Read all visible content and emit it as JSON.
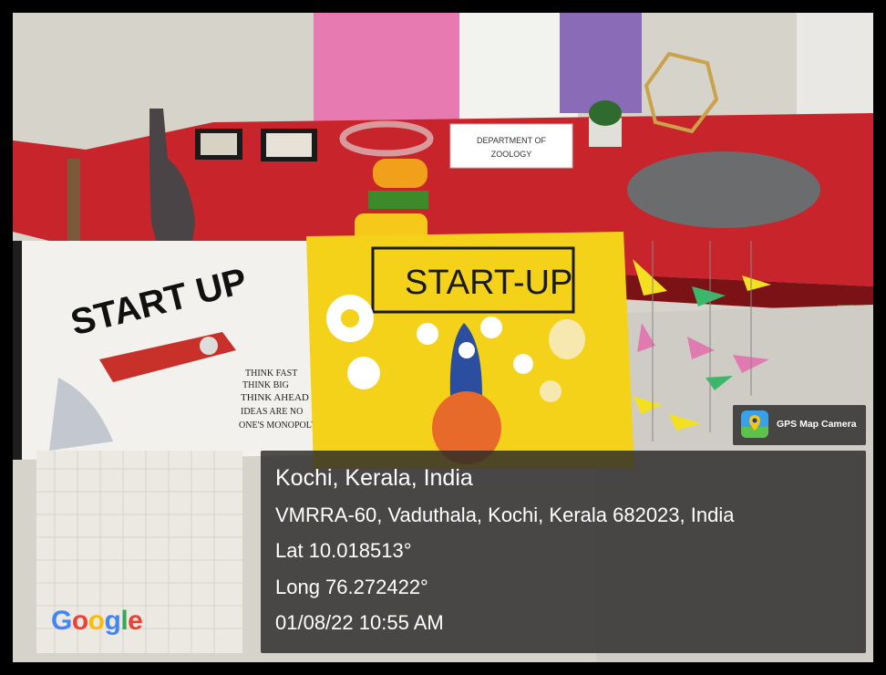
{
  "photo": {
    "sign_line1": "DEPARTMENT OF",
    "sign_line2": "ZOOLOGY",
    "poster_left_title": "START UP",
    "poster_left_lines": [
      "THINK FAST",
      "THINK BIG",
      "THINK AHEAD",
      "IDEAS ARE NO",
      "ONE'S MONOPOLY"
    ],
    "poster_right_title": "START-UP"
  },
  "map": {
    "logo_letters": [
      {
        "ch": "G",
        "color": "#4285F4"
      },
      {
        "ch": "o",
        "color": "#EA4335"
      },
      {
        "ch": "o",
        "color": "#FBBC05"
      },
      {
        "ch": "g",
        "color": "#4285F4"
      },
      {
        "ch": "l",
        "color": "#34A853"
      },
      {
        "ch": "e",
        "color": "#EA4335"
      }
    ]
  },
  "gps_badge": {
    "icon": "gps-map-camera-icon",
    "label": "GPS Map Camera"
  },
  "info": {
    "title": "Kochi, Kerala, India",
    "address": "VMRRA-60, Vaduthala, Kochi, Kerala 682023, India",
    "lat": "Lat 10.018513°",
    "long": "Long 76.272422°",
    "datetime": "01/08/22 10:55 AM"
  }
}
